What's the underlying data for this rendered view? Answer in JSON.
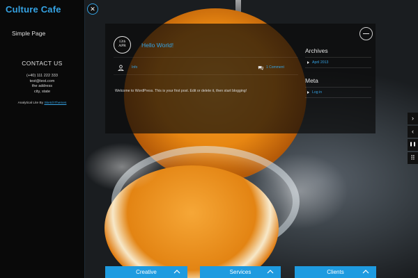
{
  "sidebar": {
    "brand": "Culture Cafe",
    "nav_simple_page": "Simple Page",
    "contact_heading": "CONTACT US",
    "phone": "(+40) 111 222 333",
    "email": "test@test.com",
    "address": "the address",
    "city_state": "city, state",
    "credit_prefix": "Analytical Lite By",
    "credit_link": "SketchThemes"
  },
  "close_button": {
    "glyph": "✕"
  },
  "post": {
    "date_day": "12th",
    "date_month": "APR",
    "title": "Hello World!",
    "author": "Info",
    "comments": "1 Comment",
    "body": "Welcome to WordPress. This is your first post. Edit or delete it, then start blogging!"
  },
  "widgets": {
    "archives_title": "Archives",
    "archives_item": "April 2013",
    "meta_title": "Meta",
    "meta_item": "Log in"
  },
  "controls": {
    "next": "›",
    "prev": "‹",
    "pause": "❚❚",
    "grid": "⠿"
  },
  "tabs": [
    {
      "label": "Creative"
    },
    {
      "label": "Services"
    },
    {
      "label": "Clients"
    }
  ],
  "colors": {
    "accent": "#35a3e4",
    "tab_bg": "#1e9be0"
  }
}
